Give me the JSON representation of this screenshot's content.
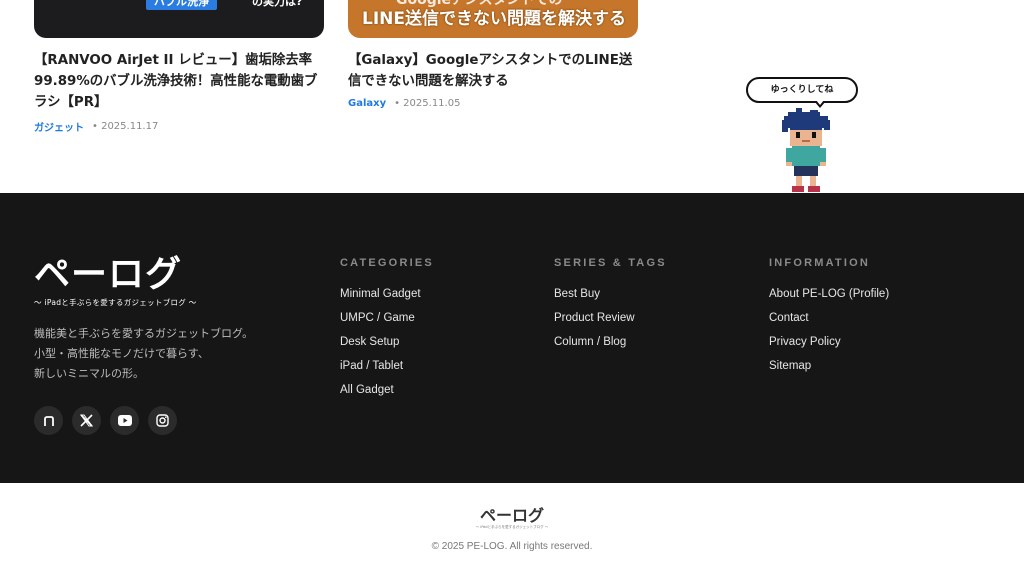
{
  "articles": [
    {
      "thumb_banner": "バブル洗浄",
      "thumb_suffix": "の実力は?",
      "title": "【RANVOO AirJet II レビュー】歯垢除去率99.89%のバブル洗浄技術！高性能な電動歯ブラシ【PR】",
      "category": "ガジェット",
      "date": "• 2025.11.17"
    },
    {
      "thumb_line1": "Googleアシスタントでの",
      "thumb_line2": "LINE送信できない問題を解決する",
      "title": "【Galaxy】GoogleアシスタントでのLINE送信できない問題を解決する",
      "category": "Galaxy",
      "date": "• 2025.11.05"
    }
  ],
  "mascot": {
    "bubble_text": "ゆっくりしてね"
  },
  "footer": {
    "logo": "ペーログ",
    "logo_sub": "～ iPadと手ぶらを愛するガジェットブログ ～",
    "description": [
      "機能美と手ぶらを愛するガジェットブログ。",
      "小型・高性能なモノだけで暮らす、",
      "新しいミニマルの形。"
    ],
    "social": [
      {
        "icon": "note-icon",
        "glyph": "n"
      },
      {
        "icon": "x-icon",
        "glyph": "X"
      },
      {
        "icon": "youtube-icon",
        "glyph": "▶"
      },
      {
        "icon": "instagram-icon",
        "glyph": "◎"
      }
    ],
    "columns": {
      "categories": {
        "heading": "CATEGORIES",
        "links": [
          "Minimal Gadget",
          "UMPC / Game",
          "Desk Setup",
          "iPad / Tablet",
          "All Gadget"
        ]
      },
      "series": {
        "heading": "SERIES & TAGS",
        "links": [
          "Best Buy",
          "Product Review",
          "Column / Blog"
        ]
      },
      "information": {
        "heading": "INFORMATION",
        "links": [
          "About PE-LOG (Profile)",
          "Contact",
          "Privacy Policy",
          "Sitemap"
        ]
      }
    }
  },
  "bottom": {
    "mini_logo": "ペーログ",
    "mini_sub": "～ iPadと手ぶらを愛するガジェットブログ ～",
    "copyright": "© 2025 PE-LOG. All rights reserved."
  },
  "colors": {
    "footer_bg": "#161616",
    "accent_link": "#1f7ae0",
    "thumb_orange": "#c5762a"
  }
}
